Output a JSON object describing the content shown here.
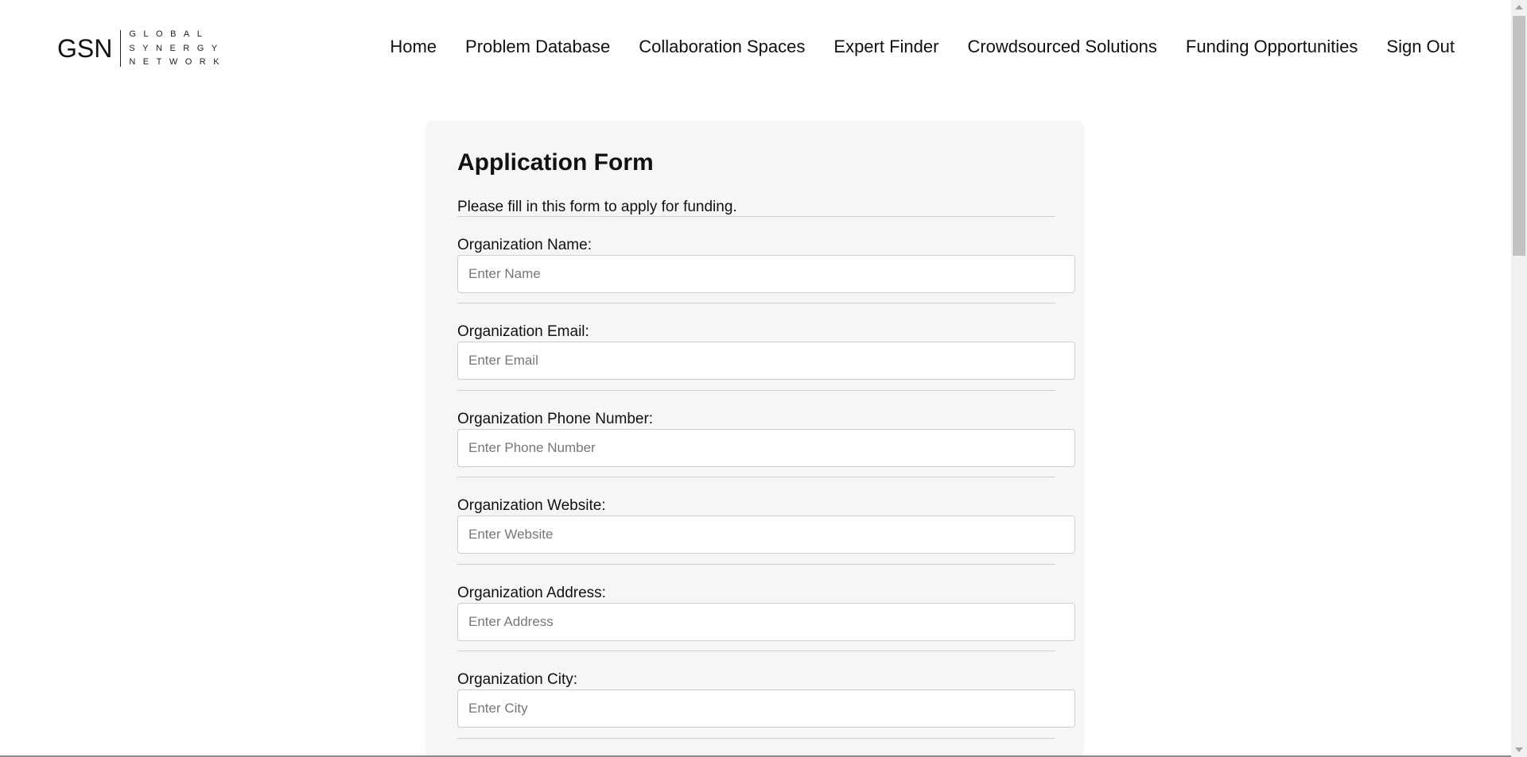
{
  "logo": {
    "mark": "GSN",
    "words": [
      "GLOBAL",
      "SYNERGY",
      "NETWORK"
    ]
  },
  "nav": [
    {
      "label": "Home"
    },
    {
      "label": "Problem Database"
    },
    {
      "label": "Collaboration Spaces"
    },
    {
      "label": "Expert Finder"
    },
    {
      "label": "Crowdsourced Solutions"
    },
    {
      "label": "Funding Opportunities"
    },
    {
      "label": "Sign Out"
    }
  ],
  "form": {
    "title": "Application Form",
    "intro": "Please fill in this form to apply for funding.",
    "fields": [
      {
        "label": "Organization Name:",
        "placeholder": "Enter Name",
        "value": ""
      },
      {
        "label": "Organization Email:",
        "placeholder": "Enter Email",
        "value": ""
      },
      {
        "label": "Organization Phone Number:",
        "placeholder": "Enter Phone Number",
        "value": ""
      },
      {
        "label": "Organization Website:",
        "placeholder": "Enter Website",
        "value": ""
      },
      {
        "label": "Organization Address:",
        "placeholder": "Enter Address",
        "value": ""
      },
      {
        "label": "Organization City:",
        "placeholder": "Enter City",
        "value": ""
      }
    ]
  },
  "colors": {
    "card_background": "#f6f6f6",
    "input_border": "#cfcfcf",
    "text": "#111111",
    "placeholder": "#777777"
  },
  "icons": [
    "scroll-up-arrow-icon",
    "scroll-down-arrow-icon"
  ]
}
